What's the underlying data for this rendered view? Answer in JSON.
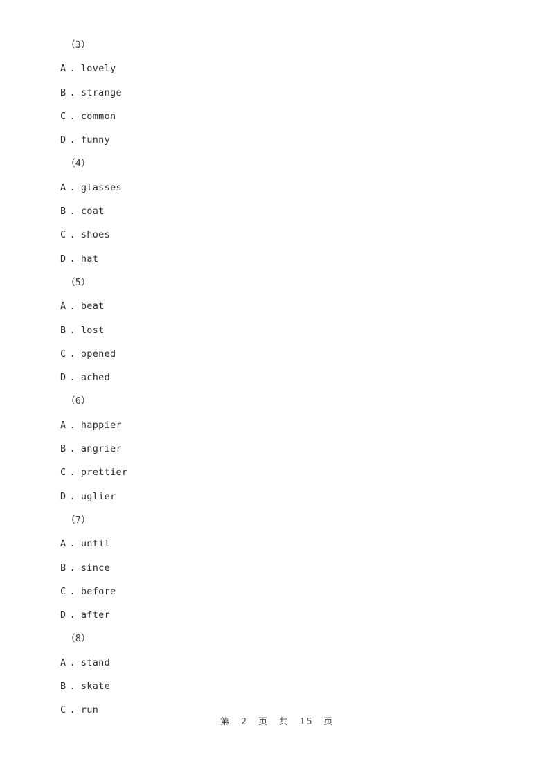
{
  "document": {
    "page_background": "#ffffff",
    "text_color": "#2e2e2e",
    "footer_text_color": "#4a4a4a"
  },
  "questions": [
    {
      "number": "（3）",
      "options": [
        {
          "label": "A",
          "sep": ".",
          "text": "lovely"
        },
        {
          "label": "B",
          "sep": ".",
          "text": "strange"
        },
        {
          "label": "C",
          "sep": ".",
          "text": "common"
        },
        {
          "label": "D",
          "sep": ".",
          "text": "funny"
        }
      ]
    },
    {
      "number": "（4）",
      "options": [
        {
          "label": "A",
          "sep": ".",
          "text": "glasses"
        },
        {
          "label": "B",
          "sep": ".",
          "text": "coat"
        },
        {
          "label": "C",
          "sep": ".",
          "text": "shoes"
        },
        {
          "label": "D",
          "sep": ".",
          "text": "hat"
        }
      ]
    },
    {
      "number": "（5）",
      "options": [
        {
          "label": "A",
          "sep": ".",
          "text": "beat"
        },
        {
          "label": "B",
          "sep": ".",
          "text": "lost"
        },
        {
          "label": "C",
          "sep": ".",
          "text": "opened"
        },
        {
          "label": "D",
          "sep": ".",
          "text": "ached"
        }
      ]
    },
    {
      "number": "（6）",
      "options": [
        {
          "label": "A",
          "sep": ".",
          "text": "happier"
        },
        {
          "label": "B",
          "sep": ".",
          "text": "angrier"
        },
        {
          "label": "C",
          "sep": ".",
          "text": "prettier"
        },
        {
          "label": "D",
          "sep": ".",
          "text": "uglier"
        }
      ]
    },
    {
      "number": "（7）",
      "options": [
        {
          "label": "A",
          "sep": ".",
          "text": "until"
        },
        {
          "label": "B",
          "sep": ".",
          "text": "since"
        },
        {
          "label": "C",
          "sep": ".",
          "text": "before"
        },
        {
          "label": "D",
          "sep": ".",
          "text": "after"
        }
      ]
    },
    {
      "number": "（8）",
      "options": [
        {
          "label": "A",
          "sep": ".",
          "text": "stand"
        },
        {
          "label": "B",
          "sep": ".",
          "text": "skate"
        },
        {
          "label": "C",
          "sep": ".",
          "text": "run"
        }
      ]
    }
  ],
  "footer": {
    "prefix": "第",
    "current_page": "2",
    "page_unit_1": "页",
    "middle": "共",
    "total_pages": "15",
    "page_unit_2": "页"
  }
}
